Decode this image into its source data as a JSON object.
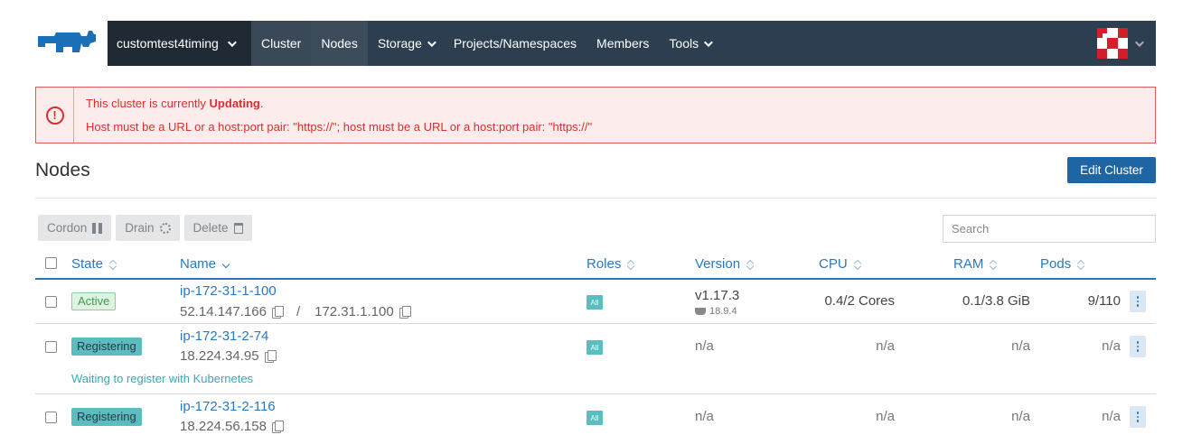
{
  "header": {
    "cluster_name": "customtest4timing",
    "nav": [
      "Cluster",
      "Nodes",
      "Storage",
      "Projects/Namespaces",
      "Members",
      "Tools"
    ]
  },
  "banner": {
    "prefix": "This cluster is currently ",
    "state": "Updating",
    "suffix": ".",
    "error": "Host must be a URL or a host:port pair: \"https://\"; host must be a URL or a host:port pair: \"https://\""
  },
  "page": {
    "title": "Nodes",
    "edit_button": "Edit Cluster"
  },
  "actions": {
    "cordon": "Cordon",
    "drain": "Drain",
    "delete": "Delete",
    "search_placeholder": "Search"
  },
  "table": {
    "headers": {
      "state": "State",
      "name": "Name",
      "roles": "Roles",
      "version": "Version",
      "cpu": "CPU",
      "ram": "RAM",
      "pods": "Pods"
    },
    "rows": [
      {
        "state": "Active",
        "name": "ip-172-31-1-100",
        "public_ip": "52.14.147.166",
        "separator": "/",
        "private_ip": "172.31.1.100",
        "role": "All",
        "version": "v1.17.3",
        "docker_version": "18.9.4",
        "cpu": "0.4/2 Cores",
        "ram": "0.1/3.8 GiB",
        "pods": "9/110"
      },
      {
        "state": "Registering",
        "name": "ip-172-31-2-74",
        "public_ip": "18.224.34.95",
        "role": "All",
        "version": "n/a",
        "cpu": "n/a",
        "ram": "n/a",
        "pods": "n/a",
        "message": "Waiting to register with Kubernetes"
      },
      {
        "state": "Registering",
        "name": "ip-172-31-2-116",
        "public_ip": "18.224.56.158",
        "role": "All",
        "version": "n/a",
        "cpu": "n/a",
        "ram": "n/a",
        "pods": "n/a"
      }
    ]
  },
  "colors": {
    "nav_bg": "#2c3e50",
    "primary": "#1e66a3",
    "link": "#2a78c0",
    "error": "#d73030",
    "registering": "#5cbcc0"
  }
}
